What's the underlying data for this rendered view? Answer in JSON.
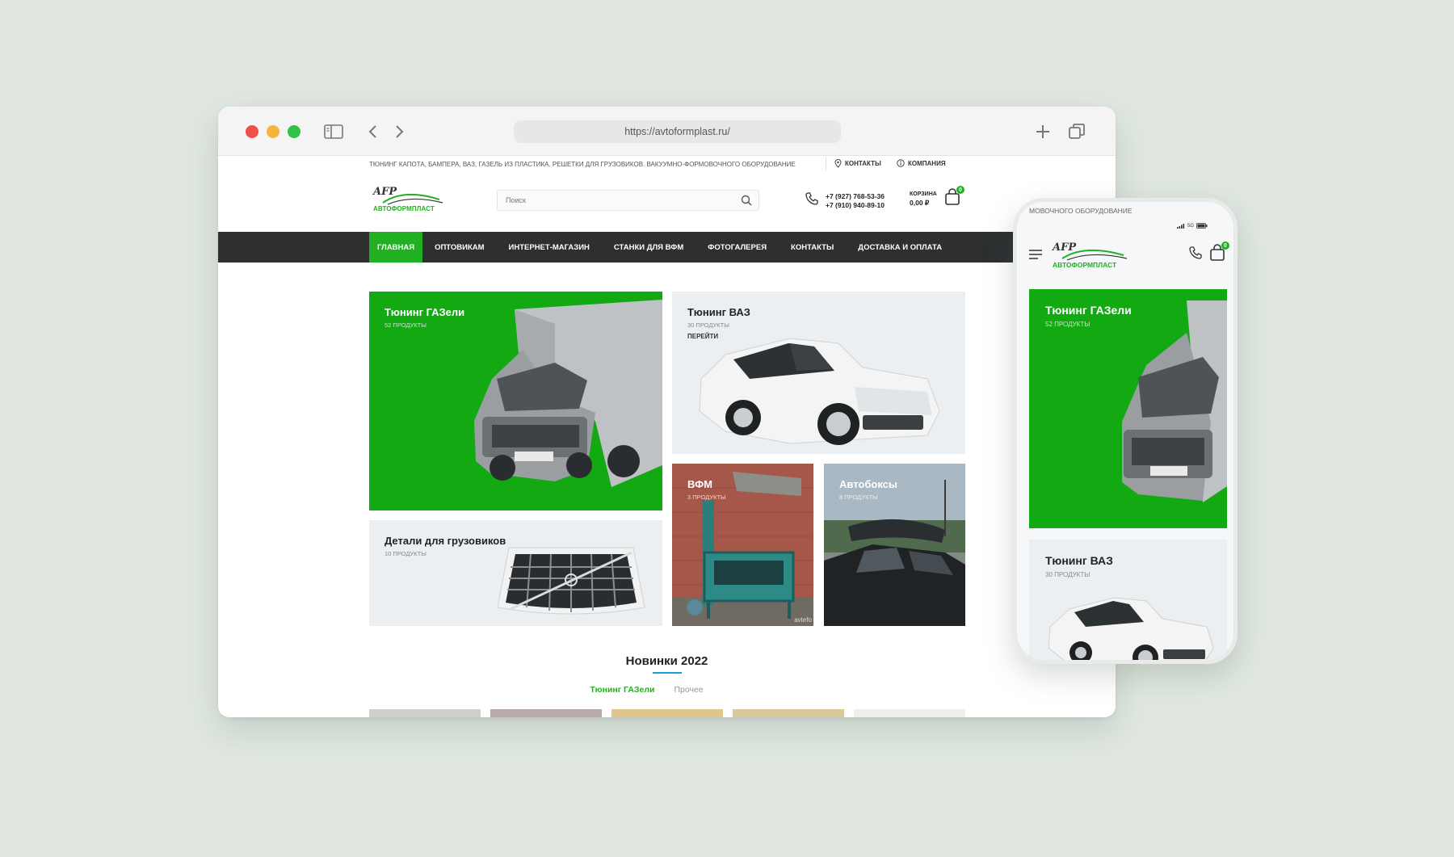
{
  "browser": {
    "url": "https://avtoformplast.ru/"
  },
  "site": {
    "tagline": "Тюнинг капота, бампера, ВАЗ, ГАЗель из пластика. Решетки для грузовиков. Вакуумно-формовочного оборудование",
    "top_links": [
      "КОНТАКТЫ",
      "КОМПАНИЯ"
    ],
    "logo_text": "АВТОФОРМПЛАСТ",
    "logo_mark": "AFP",
    "search_placeholder": "Поиск",
    "phones": [
      "+7 (927) 768-53-36",
      "+7 (910) 940-89-10"
    ],
    "cart": {
      "label": "КОРЗИНА",
      "sum": "0,00 ₽",
      "count": "0"
    },
    "nav": [
      "ГЛАВНАЯ",
      "ОПТОВИКАМ",
      "ИНТЕРНЕТ-МАГАЗИН",
      "СТАНКИ ДЛЯ ВФМ",
      "ФОТОГАЛЕРЕЯ",
      "КОНТАКТЫ",
      "ДОСТАВКА И ОПЛАТА"
    ],
    "tiles": [
      {
        "title": "Тюнинг ГАЗели",
        "sub": "52 ПРОДУКТЫ"
      },
      {
        "title": "Тюнинг ВАЗ",
        "sub": "30 ПРОДУКТЫ",
        "extra": "ПЕРЕЙТИ"
      },
      {
        "title": "ВФМ",
        "sub": "3 ПРОДУКТЫ",
        "watermark": "avtefo"
      },
      {
        "title": "Автобоксы",
        "sub": "8 ПРОДУКТЫ"
      },
      {
        "title": "Детали для грузовиков",
        "sub": "10 ПРОДУКТЫ"
      }
    ],
    "section_title": "Новинки 2022",
    "section_tabs": [
      "Тюнинг ГАЗели",
      "Прочее"
    ]
  },
  "phone": {
    "top_text": "МОВОЧНОГО ОБОРУДОВАНИЕ",
    "status": "5G",
    "cart_count": "0",
    "tiles": [
      {
        "title": "Тюнинг ГАЗели",
        "sub": "52 ПРОДУКТЫ"
      },
      {
        "title": "Тюнинг ВАЗ",
        "sub": "30 ПРОДУКТЫ"
      }
    ]
  },
  "colors": {
    "accent": "#21b021",
    "nav_bg": "#2d2f31",
    "background": "#dfe7e0",
    "tab_underline": "#1e9dd8"
  }
}
